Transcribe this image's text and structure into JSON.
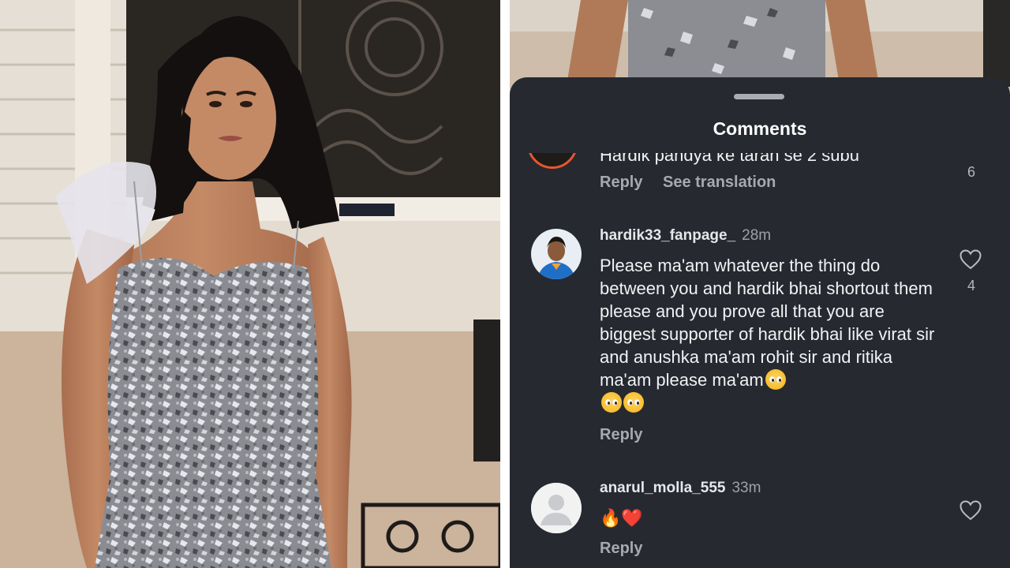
{
  "sheet": {
    "title": "Comments"
  },
  "comments": [
    {
      "id": "partial",
      "text_partial": "Hardik pandya ke tarah se 2 subu",
      "reply_label": "Reply",
      "translate_label": "See translation",
      "likes": "6"
    },
    {
      "id": "hardik-fan",
      "username": "hardik33_fanpage_",
      "time": "28m",
      "text": "Please ma'am whatever the thing do between you and hardik bhai shortout them please and you prove all that you are biggest supporter of hardik bhai like virat sir and anushka ma'am rohit sir and ritika ma'am please ma'am",
      "reply_label": "Reply",
      "likes": "4",
      "avatar_icon": "cricketer-avatar"
    },
    {
      "id": "anarul",
      "username": "anarul_molla_555",
      "time": "33m",
      "text": "🔥❤️",
      "reply_label": "Reply",
      "avatar_icon": "default-user-avatar"
    }
  ],
  "icons": {
    "like": "heart-outline-icon",
    "emoji": "pleading-face-emoji"
  },
  "colors": {
    "sheet_background": "#262930",
    "text_primary": "#f2f2f4",
    "text_secondary": "#a6a9b0"
  }
}
